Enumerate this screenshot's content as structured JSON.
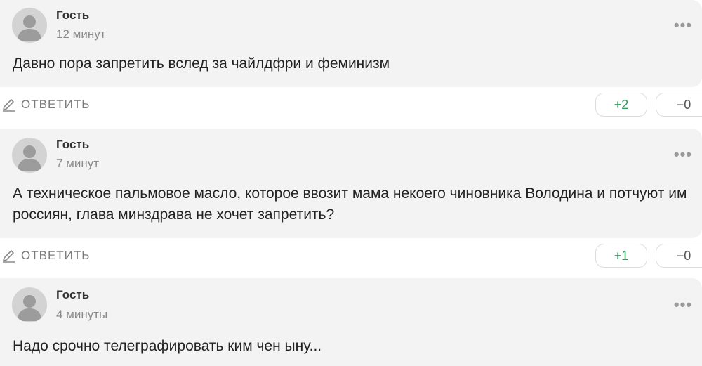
{
  "comments": [
    {
      "author": "Гость",
      "time": "12 минут",
      "text": "Давно пора запретить вслед за чайлдфри и феминизм",
      "reply_label": "ОТВЕТИТЬ",
      "likes": "+2",
      "dislikes": "−0"
    },
    {
      "author": "Гость",
      "time": "7 минут",
      "text": "А техническое пальмовое масло, которое ввозит мама некоего чиновника Володина и потчуют им россиян, глава минздрава не хочет запретить?",
      "reply_label": "ОТВЕТИТЬ",
      "likes": "+1",
      "dislikes": "−0"
    },
    {
      "author": "Гость",
      "time": "4 минуты",
      "text": "Надо срочно телеграфировать ким чен ыну..."
    }
  ],
  "more_glyph": "•••",
  "icons": {
    "avatar": "user-silhouette-icon",
    "reply": "pencil-icon",
    "more": "more-dots-icon"
  },
  "colors": {
    "card_bg": "#f3f3f3",
    "plus": "#2e9e59",
    "muted": "#8a8a8a"
  }
}
